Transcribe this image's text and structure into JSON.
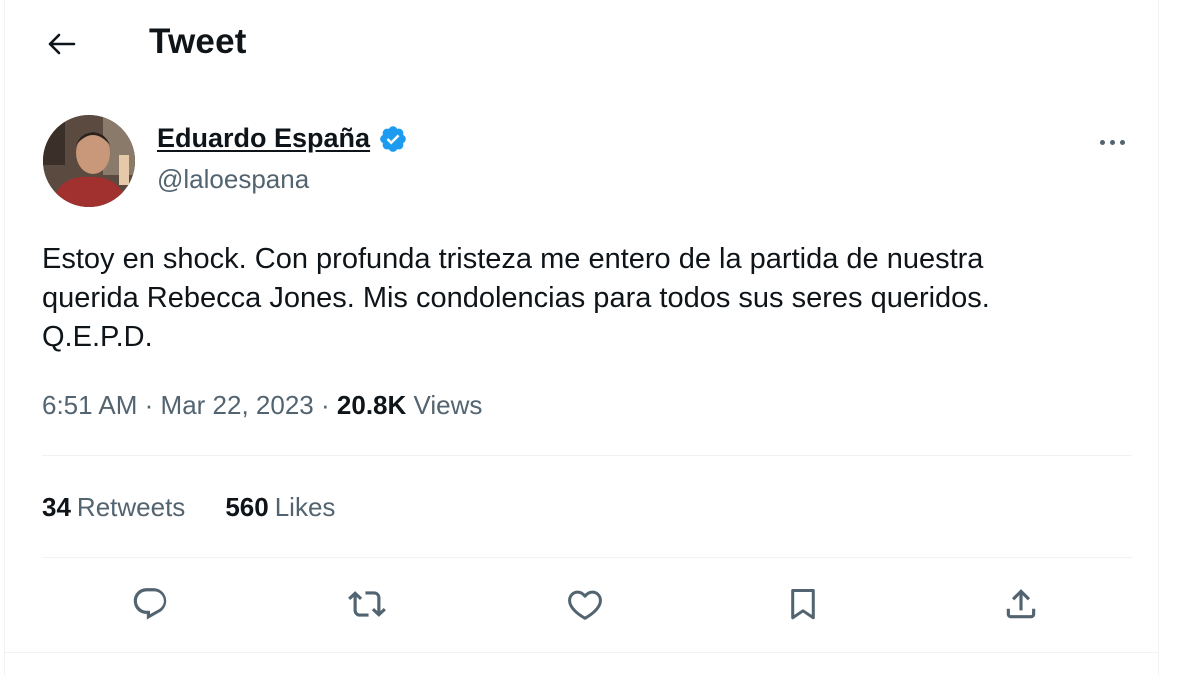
{
  "header": {
    "title": "Tweet",
    "back_icon": "arrow-left-icon"
  },
  "tweet": {
    "author": {
      "name": "Eduardo España",
      "handle": "@laloespana",
      "verified": true,
      "verified_color": "#1d9bf0"
    },
    "text": "Estoy en shock. Con profunda tristeza me entero de la partida de nuestra\nquerida Rebecca Jones. Mis condolencias para todos sus seres queridos.\nQ.E.P.D.",
    "time": "6:51 AM",
    "separator": "·",
    "date": "Mar 22, 2023",
    "views_count": "20.8K",
    "views_label": "Views",
    "retweets_count": "34",
    "retweets_label": "Retweets",
    "likes_count": "560",
    "likes_label": "Likes"
  },
  "actions": [
    "reply-icon",
    "retweet-icon",
    "like-icon",
    "bookmark-icon",
    "share-icon"
  ],
  "colors": {
    "text_primary": "#0f1419",
    "text_secondary": "#536471",
    "border": "#eff3f4",
    "accent": "#1d9bf0"
  }
}
